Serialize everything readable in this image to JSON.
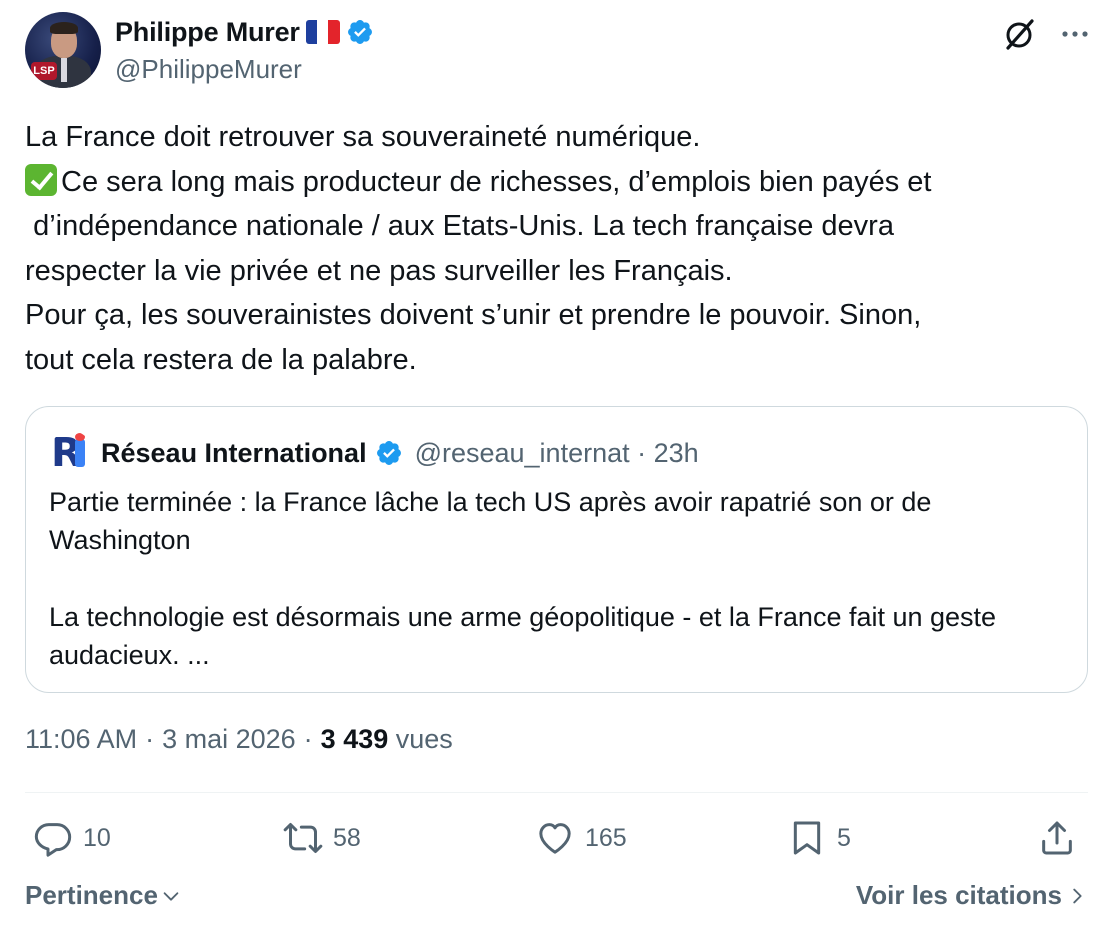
{
  "author": {
    "name": "Philippe Murer",
    "handle": "@PhilippeMurer",
    "flag": "France",
    "verified": true,
    "avatar_logo": "LSP"
  },
  "tweet": {
    "line1": "La France doit retrouver sa souveraineté numérique.",
    "line2_after_check": "Ce sera long mais producteur de richesses, d’emplois bien payés et",
    "line3": " d’indépendance nationale / aux Etats-Unis. La tech française devra",
    "line4": "respecter la vie privée et ne pas surveiller les Français.",
    "line5": "Pour ça, les souverainistes doivent s’unir et prendre le pouvoir. Sinon,",
    "line6": "tout cela restera de la palabre."
  },
  "quote": {
    "name": "Réseau International",
    "handle_time": "@reseau_internat · 23h",
    "verified": true,
    "text": "Partie terminée : la France lâche la tech US après avoir rapatrié son or de\nWashington\n\nLa technologie est désormais une arme géopolitique - et la France fait un geste\naudacieux. ..."
  },
  "meta": {
    "time": "11:06 AM",
    "sep1": "·",
    "date": "3 mai 2026",
    "sep2": "·",
    "views_count": "3 439",
    "views_label": "vues"
  },
  "actions": {
    "replies": "10",
    "reposts": "58",
    "likes": "165",
    "bookmarks": "5"
  },
  "footer": {
    "sort_label": "Pertinence",
    "citations_label": "Voir les citations"
  },
  "colors": {
    "verified_blue": "#1d9bf0",
    "secondary_text": "#536471",
    "check_green": "#5cb531"
  },
  "icons": [
    "grok-icon",
    "more-icon",
    "reply-icon",
    "repost-icon",
    "like-icon",
    "bookmark-icon",
    "share-icon",
    "chevron-down-icon",
    "chevron-right-icon"
  ]
}
